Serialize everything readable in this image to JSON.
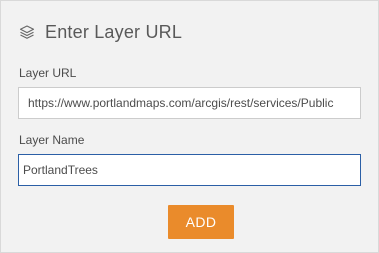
{
  "header": {
    "icon": "layers-icon",
    "title": "Enter Layer URL"
  },
  "form": {
    "url_label": "Layer URL",
    "url_value": "https://www.portlandmaps.com/arcgis/rest/services/Public",
    "name_label": "Layer Name",
    "name_value": "PortlandTrees"
  },
  "actions": {
    "add_label": "ADD"
  },
  "colors": {
    "accent_button": "#ea8b2b",
    "focus_border": "#2b5fa6",
    "panel_background": "#f2f2f2"
  }
}
